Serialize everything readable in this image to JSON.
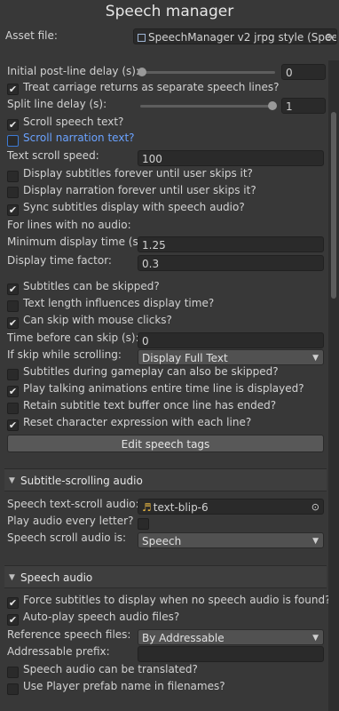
{
  "window": {
    "title": "Speech manager"
  },
  "asset_file": {
    "label": "Asset file:",
    "value": "SpeechManager v2 jrpg style (Spee"
  },
  "settings": {
    "initial_delay": {
      "label": "Initial post-line delay (s):",
      "value": "0",
      "slider_level": 0
    },
    "treat_cr": {
      "label": "Treat carriage returns as separate speech lines?",
      "checked": true
    },
    "split_delay": {
      "label": "Split line delay (s):",
      "value": "1",
      "slider_level": 1
    },
    "scroll_speech": {
      "label": "Scroll speech text?",
      "checked": true
    },
    "scroll_narration": {
      "label": "Scroll narration text?",
      "checked": false
    },
    "text_scroll_speed": {
      "label": "Text scroll speed:",
      "value": "100"
    },
    "display_subs_forever": {
      "label": "Display subtitles forever until user skips it?",
      "checked": false
    },
    "display_narr_forever": {
      "label": "Display narration forever until user skips it?",
      "checked": false
    },
    "sync_subs": {
      "label": "Sync subtitles display with speech audio?",
      "checked": true
    },
    "no_audio_heading": "For lines with no audio:",
    "min_display_time": {
      "label": "Minimum display time (s):",
      "value": "1.25"
    },
    "display_time_factor": {
      "label": "Display time factor:",
      "value": "0.3"
    },
    "subs_skipped": {
      "label": "Subtitles can be skipped?",
      "checked": true
    },
    "text_length": {
      "label": "Text length influences display time?",
      "checked": false
    },
    "mouse_skip": {
      "label": "Can skip with mouse clicks?",
      "checked": true
    },
    "time_before_skip": {
      "label": "Time before can skip (s):",
      "value": "0"
    },
    "skip_scrolling": {
      "label": "If skip while scrolling:",
      "value": "Display Full Text"
    },
    "gameplay_skip": {
      "label": "Subtitles during gameplay can also be skipped?",
      "checked": false
    },
    "talking_anims": {
      "label": "Play talking animations entire time line is displayed?",
      "checked": true
    },
    "retain_buffer": {
      "label": "Retain subtitle text buffer once line has ended?",
      "checked": false
    },
    "reset_expression": {
      "label": "Reset character expression with each line?",
      "checked": true
    },
    "edit_tags_button": "Edit speech tags"
  },
  "subtitle_audio": {
    "header": "Subtitle-scrolling audio",
    "clip": {
      "label": "Speech text-scroll audio:",
      "value": "text-blip-6"
    },
    "every_letter": {
      "label": "Play audio every letter?",
      "checked": false
    },
    "scroll_audio_is": {
      "label": "Speech scroll audio is:",
      "value": "Speech"
    }
  },
  "speech_audio": {
    "header": "Speech audio",
    "force_subs": {
      "label": "Force subtitles to display when no speech audio is found?",
      "checked": true
    },
    "autoplay": {
      "label": "Auto-play speech audio files?",
      "checked": true
    },
    "reference_files": {
      "label": "Reference speech files:",
      "value": "By Addressable"
    },
    "addressable_prefix": {
      "label": "Addressable prefix:",
      "value": ""
    },
    "translated": {
      "label": "Speech audio can be translated?",
      "checked": false
    },
    "player_prefab": {
      "label": "Use Player prefab name in filenames?",
      "checked": false
    }
  },
  "icons": {
    "check": "✔",
    "dropdown": "▼",
    "section_arrow": "▼",
    "picker": "⊙"
  },
  "colors": {
    "background": "#383838",
    "accent": "#3d7bd6",
    "focus_text": "#6aa2ff"
  }
}
